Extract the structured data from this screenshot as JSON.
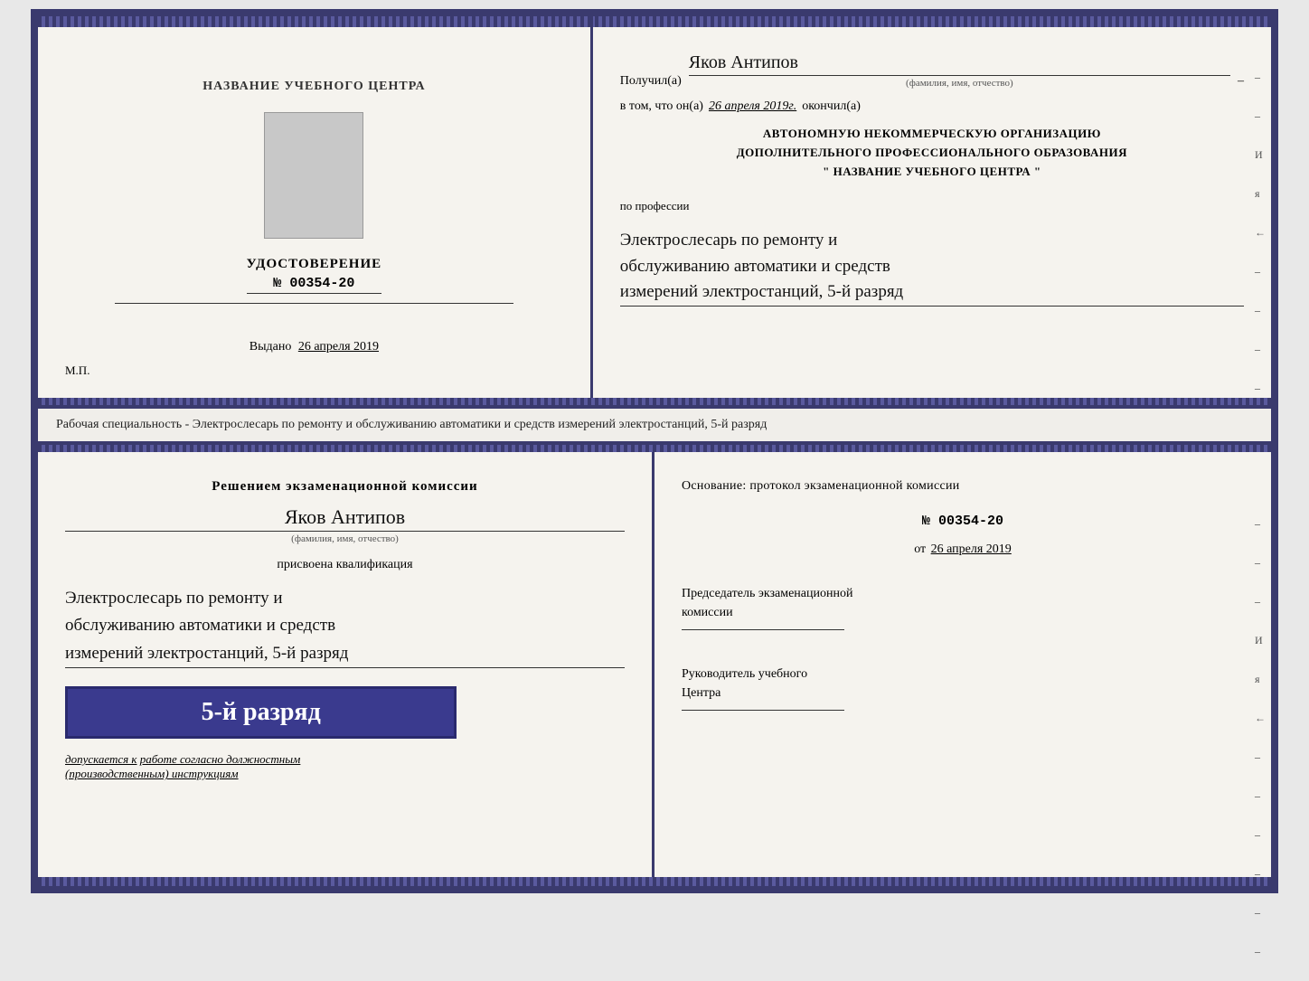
{
  "top": {
    "left": {
      "school_name": "НАЗВАНИЕ УЧЕБНОГО ЦЕНТРА",
      "cert_title": "УДОСТОВЕРЕНИЕ",
      "cert_number": "№ 00354-20",
      "issued_label": "Выдано",
      "issued_date": "26 апреля 2019",
      "mp_label": "М.П."
    },
    "right": {
      "received_label": "Получил(а)",
      "recipient_name": "Яков Антипов",
      "fio_sub": "(фамилия, имя, отчество)",
      "in_that_label": "в том, что он(а)",
      "date_value": "26 апреля 2019г.",
      "finished_label": "окончил(а)",
      "org_line1": "АВТОНОМНУЮ НЕКОММЕРЧЕСКУЮ ОРГАНИЗАЦИЮ",
      "org_line2": "ДОПОЛНИТЕЛЬНОГО ПРОФЕССИОНАЛЬНОГО ОБРАЗОВАНИЯ",
      "org_line3": "\"   НАЗВАНИЕ УЧЕБНОГО ЦЕНТРА   \"",
      "profession_label": "по профессии",
      "profession_line1": "Электрослесарь по ремонту и",
      "profession_line2": "обслуживанию автоматики и средств",
      "profession_line3": "измерений электростанций, 5-й разряд"
    }
  },
  "middle": {
    "text": "Рабочая специальность - Электрослесарь по ремонту и обслуживанию автоматики и средств измерений электростанций, 5-й разряд"
  },
  "bottom": {
    "left": {
      "decision_title": "Решением экзаменационной комиссии",
      "person_name": "Яков Антипов",
      "fio_sub": "(фамилия, имя, отчество)",
      "qualification_label": "присвоена квалификация",
      "qual_line1": "Электрослесарь по ремонту и",
      "qual_line2": "обслуживанию автоматики и средств",
      "qual_line3": "измерений электростанций, 5-й разряд",
      "rank_badge": "5-й разряд",
      "admission_text": "допускается к",
      "admission_underline": "работе согласно должностным",
      "admission_italic": "(производственным) инструкциям"
    },
    "right": {
      "basis_label": "Основание: протокол экзаменационной комиссии",
      "protocol_number": "№ 00354-20",
      "protocol_date_prefix": "от",
      "protocol_date": "26 апреля 2019",
      "chairman_title1": "Председатель экзаменационной",
      "chairman_title2": "комиссии",
      "director_title1": "Руководитель учебного",
      "director_title2": "Центра"
    }
  },
  "side_labels": {
    "and": "И",
    "ya": "я",
    "arrow": "←",
    "dashes": [
      "–",
      "–",
      "–",
      "–",
      "–",
      "–",
      "–"
    ]
  }
}
